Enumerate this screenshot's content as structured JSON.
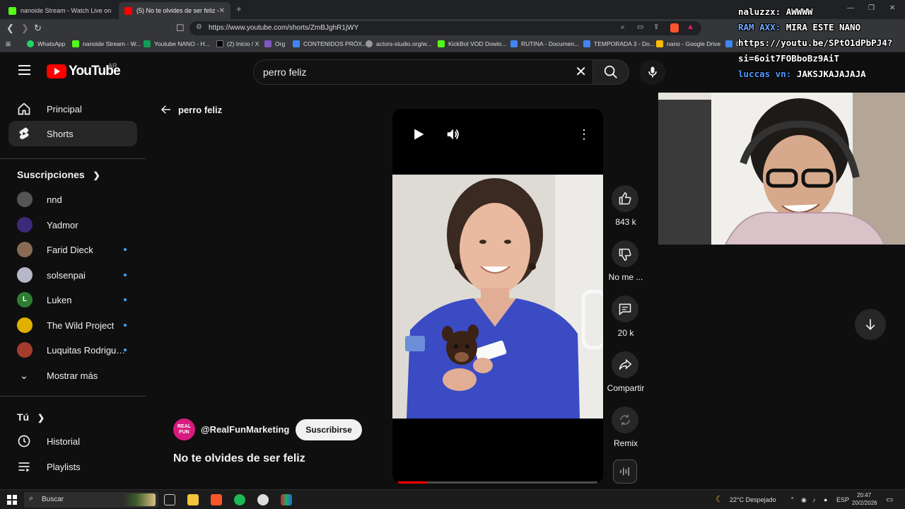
{
  "browser": {
    "tabs": [
      {
        "title": "nanoide Stream - Watch Live on Kick",
        "active": false,
        "favicon_color": "#53fc18"
      },
      {
        "title": "(5) No te olvides de ser feliz - Yo",
        "active": true,
        "favicon_color": "#ff0000"
      }
    ],
    "url": "https://www.youtube.com/shorts/ZmBJghR1jWY",
    "bookmarks": [
      {
        "label": "WhatsApp",
        "color": "#25d366"
      },
      {
        "label": "nanoide Stream - W...",
        "color": "#53fc18"
      },
      {
        "label": "Youtube NANO - H...",
        "color": "#0f9d58"
      },
      {
        "label": "(2) Inicio / X",
        "color": "#ffffff"
      },
      {
        "label": "Org",
        "color": "#7e57c2"
      },
      {
        "label": "CONTENIDOS PRÓX...",
        "color": "#4285f4"
      },
      {
        "label": "actors-studio.org/w...",
        "color": "#999999"
      },
      {
        "label": "KickBot VOD Dowlo...",
        "color": "#53fc18"
      },
      {
        "label": "RUTINA - Documen...",
        "color": "#4285f4"
      },
      {
        "label": "TEMPORADA 3 - Do...",
        "color": "#4285f4"
      },
      {
        "label": "nano - Google Drive",
        "color": "#fbbc04"
      },
      {
        "label": "D",
        "color": "#4285f4"
      }
    ]
  },
  "youtube": {
    "logo_text": "YouTube",
    "country_code": "AR",
    "search_value": "perro feliz",
    "sidebar": {
      "main": [
        {
          "label": "Principal",
          "icon": "home-icon",
          "active": false
        },
        {
          "label": "Shorts",
          "icon": "shorts-icon",
          "active": true
        }
      ],
      "subscriptions_header": "Suscripciones",
      "subscriptions": [
        {
          "label": "nnd",
          "avatar_color": "#555555",
          "initial": "",
          "new": false
        },
        {
          "label": "Yadmor",
          "avatar_color": "#3b2a7a",
          "initial": "",
          "new": false
        },
        {
          "label": "Farid Dieck",
          "avatar_color": "#8a6a55",
          "initial": "",
          "new": true
        },
        {
          "label": "solsenpai",
          "avatar_color": "#b7b7c7",
          "initial": "",
          "new": true
        },
        {
          "label": "Luken",
          "avatar_color": "#2e7d32",
          "initial": "L",
          "new": true
        },
        {
          "label": "The Wild Project",
          "avatar_color": "#e0b000",
          "initial": "",
          "new": true
        },
        {
          "label": "Luquitas Rodriguez",
          "avatar_color": "#a33c2c",
          "initial": "",
          "new": true
        }
      ],
      "show_more": "Mostrar más",
      "you_header": "Tú",
      "you_items": [
        {
          "label": "Historial",
          "icon": "history-icon"
        },
        {
          "label": "Playlists",
          "icon": "playlists-icon"
        }
      ]
    },
    "back_label": "perro feliz",
    "short": {
      "like_count": "843 k",
      "dislike_label": "No me ...",
      "comments_count": "20 k",
      "share_label": "Compartir",
      "remix_label": "Remix",
      "channel_handle": "@RealFunMarketing",
      "channel_avatar_text": "REAL FUN",
      "subscribe_label": "Suscribirse",
      "title": "No te olvides de ser feliz",
      "progress": 0.15
    }
  },
  "stream_overlay": {
    "chat": [
      {
        "user": "naluzzx:",
        "message": "AWWWW",
        "user_color": "#ffffff"
      },
      {
        "user": "RAM AXX:",
        "message": "MIRA ESTE NANO",
        "user_color": "#6fa8ff"
      },
      {
        "user": "",
        "message": "https://youtu.be/SPtO1dPbPJ4?",
        "user_color": "#ffffff"
      },
      {
        "user": "",
        "message": "si=6oit7FOBboBz9AiT",
        "user_color": "#ffffff"
      },
      {
        "user": "luccas vn:",
        "message": "JAKSJKAJAJAJA",
        "user_color": "#4f9cff"
      }
    ]
  },
  "taskbar": {
    "search_placeholder": "Buscar",
    "weather": "22°C  Despejado",
    "language": "ESP",
    "time": "20:47",
    "date": "20/2/2026"
  }
}
